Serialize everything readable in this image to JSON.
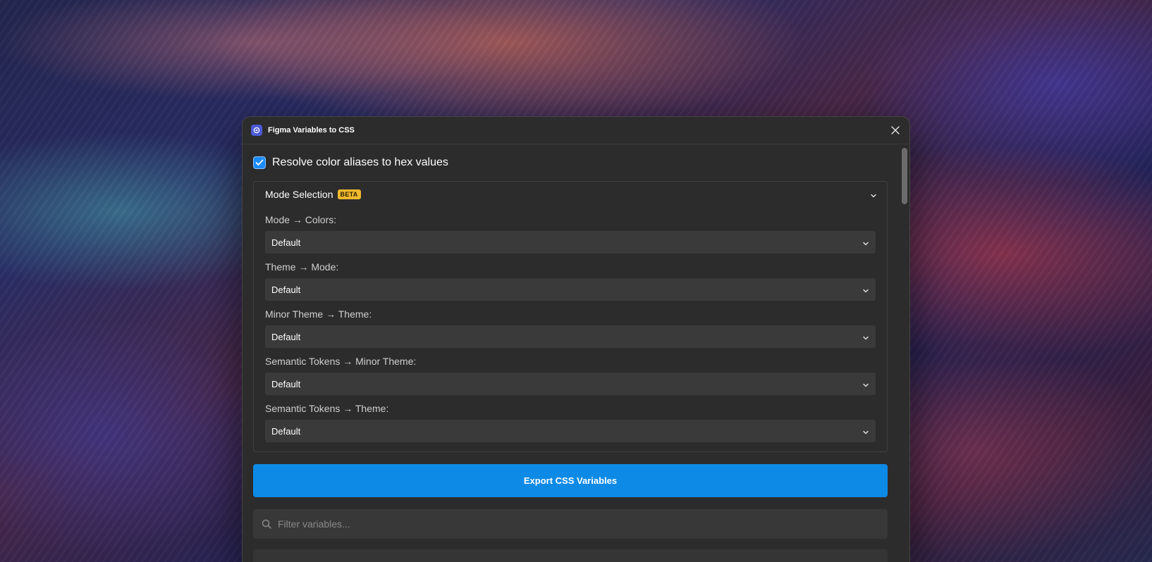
{
  "window": {
    "title": "Figma Variables to CSS"
  },
  "options": {
    "resolve_aliases_label": "Resolve color aliases to hex values",
    "resolve_aliases_checked": true
  },
  "mode_selection": {
    "title": "Mode Selection",
    "badge": "BETA",
    "modes": [
      {
        "label": "Mode → Colors:",
        "value": "Default"
      },
      {
        "label": "Theme → Mode:",
        "value": "Default"
      },
      {
        "label": "Minor Theme → Theme:",
        "value": "Default"
      },
      {
        "label": "Semantic Tokens → Minor Theme:",
        "value": "Default"
      },
      {
        "label": "Semantic Tokens → Theme:",
        "value": "Default"
      }
    ]
  },
  "actions": {
    "export_label": "Export CSS Variables"
  },
  "filter": {
    "placeholder": "Filter variables..."
  },
  "colors": {
    "accent": "#0d8ae6",
    "badge": "#f0b82e",
    "window_bg": "#2c2c2c"
  }
}
